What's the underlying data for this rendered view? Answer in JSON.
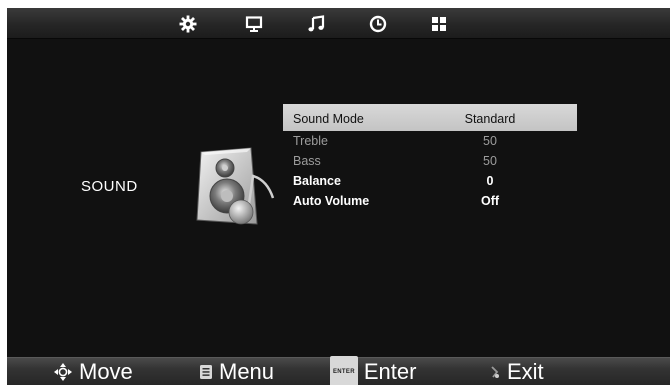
{
  "tabs": [
    {
      "icon": "gear-icon"
    },
    {
      "icon": "monitor-icon"
    },
    {
      "icon": "music-note-icon"
    },
    {
      "icon": "clock-icon"
    },
    {
      "icon": "grid-icon"
    }
  ],
  "section": {
    "label": "SOUND",
    "icon": "speaker-icon"
  },
  "menu": {
    "items": [
      {
        "label": "Sound Mode",
        "value": "Standard"
      },
      {
        "label": "Treble",
        "value": "50"
      },
      {
        "label": "Bass",
        "value": "50"
      },
      {
        "label": "Balance",
        "value": "0"
      },
      {
        "label": "Auto Volume",
        "value": "Off"
      }
    ]
  },
  "hints": {
    "move": "Move",
    "menu": "Menu",
    "enter_key": "ENTER",
    "enter": "Enter",
    "exit": "Exit"
  },
  "colors": {
    "background": "#111111",
    "highlight": "#cfcfcf",
    "text_dim": "#9c9c9c",
    "text_bright": "#ffffff"
  }
}
